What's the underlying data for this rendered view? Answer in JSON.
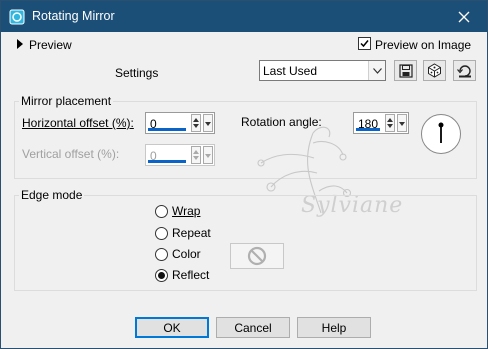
{
  "window": {
    "title": "Rotating Mirror"
  },
  "preview": {
    "label": "Preview",
    "checkbox_label": "Preview on Image",
    "checked": true
  },
  "settings": {
    "label": "Settings",
    "preset": "Last Used"
  },
  "mirror": {
    "group_label": "Mirror placement",
    "horizontal": {
      "label": "Horizontal offset (%):",
      "value": "0"
    },
    "vertical": {
      "label": "Vertical offset (%):",
      "value": "0"
    },
    "rotation": {
      "label": "Rotation angle:",
      "value": "180"
    }
  },
  "edge": {
    "group_label": "Edge mode",
    "options": [
      {
        "label": "Wrap",
        "selected": false
      },
      {
        "label": "Repeat",
        "selected": false
      },
      {
        "label": "Color",
        "selected": false
      },
      {
        "label": "Reflect",
        "selected": true
      }
    ]
  },
  "buttons": {
    "ok": "OK",
    "cancel": "Cancel",
    "help": "Help"
  },
  "watermark": "Sylviane",
  "colors": {
    "titlebar": "#1c4f78",
    "accent": "#0078d7"
  },
  "icons": [
    "app-icon",
    "close-icon",
    "save-icon",
    "randomize-icon",
    "reset-icon",
    "chevron-down-icon",
    "prohibited-icon"
  ]
}
